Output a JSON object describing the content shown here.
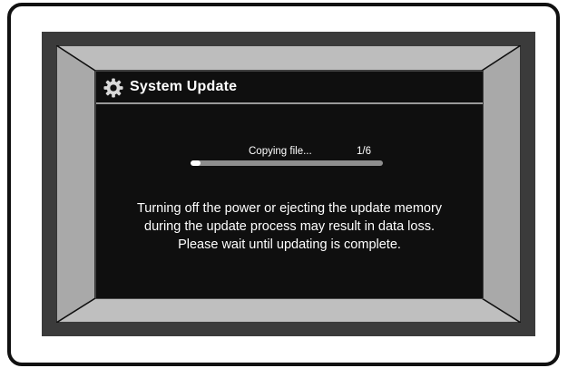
{
  "dialog": {
    "title": "System Update",
    "icon": "gear-icon"
  },
  "progress": {
    "label": "Copying file...",
    "count": "1/6",
    "fraction": 0.05
  },
  "message": {
    "lines": [
      "Turning off the power or ejecting the update memory",
      "during the update process may result in data loss.",
      "Please wait until updating is complete."
    ]
  },
  "colors": {
    "screen": "#0f0f0f",
    "bezel": "#3b3b3b",
    "bevel_top": "#b4b4b4",
    "bevel_side": "#a8a8a8",
    "text": "#ffffff"
  }
}
